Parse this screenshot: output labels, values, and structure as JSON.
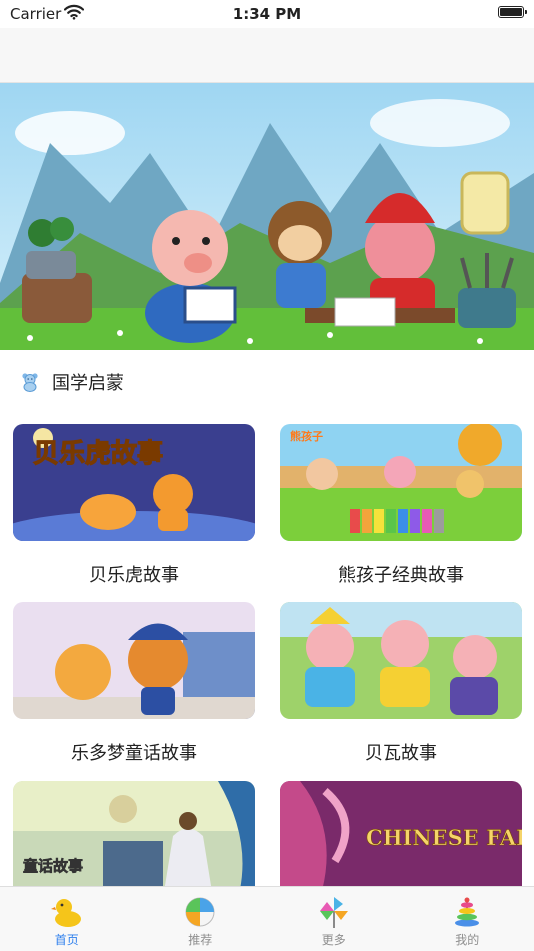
{
  "status_bar": {
    "carrier": "Carrier",
    "time": "1:34 PM"
  },
  "section": {
    "title": "国学启蒙",
    "icon": "teddy-bear-icon"
  },
  "stories": [
    {
      "title": "贝乐虎故事",
      "thumb_text": "贝乐虎故事"
    },
    {
      "title": "熊孩子经典故事",
      "thumb_text": "熊孩子"
    },
    {
      "title": "乐多梦童话故事",
      "thumb_text": ""
    },
    {
      "title": "贝瓦故事",
      "thumb_text": ""
    },
    {
      "title": "",
      "thumb_text": "童话故事"
    },
    {
      "title": "",
      "thumb_text": "CHINESE FAIRY TALES"
    }
  ],
  "tabs": [
    {
      "label": "首页",
      "icon": "duck-icon",
      "active": true
    },
    {
      "label": "推荐",
      "icon": "beach-ball-icon",
      "active": false
    },
    {
      "label": "更多",
      "icon": "pinwheel-icon",
      "active": false
    },
    {
      "label": "我的",
      "icon": "ring-stack-icon",
      "active": false
    }
  ],
  "colors": {
    "active_tab": "#2f80ed",
    "inactive_tab": "#8e8e8e"
  }
}
